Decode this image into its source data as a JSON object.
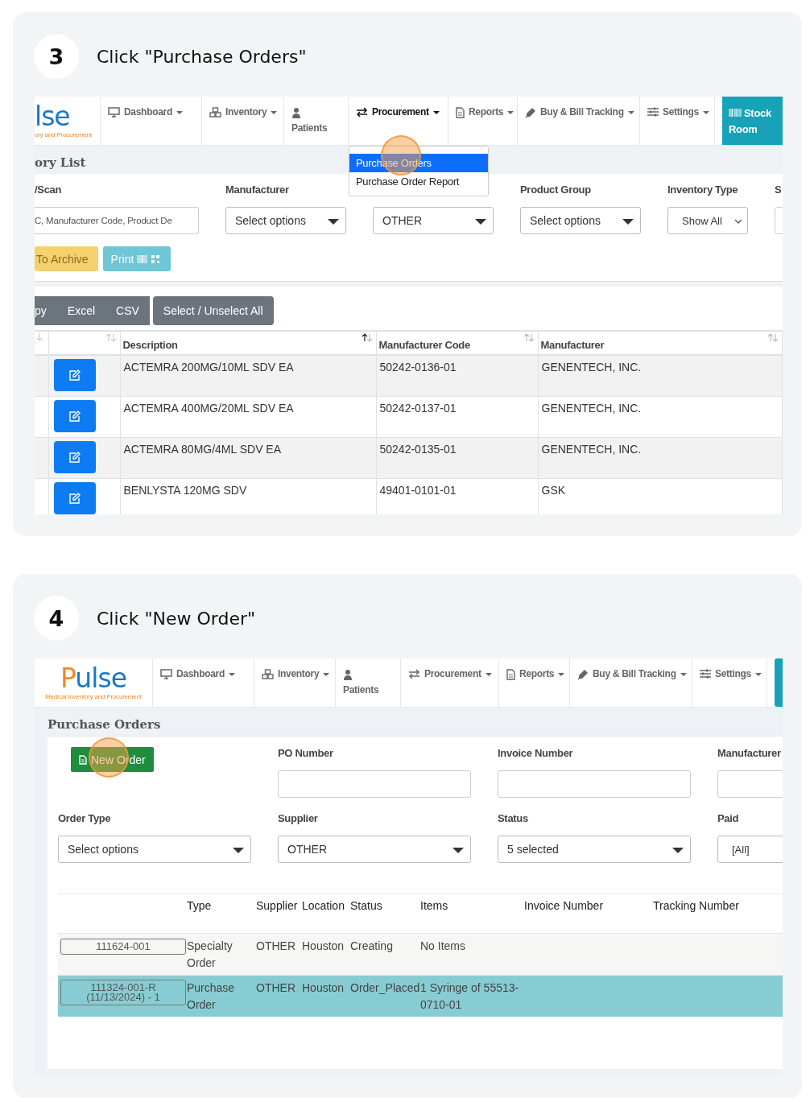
{
  "steps": [
    {
      "kind": "inventory",
      "number": "3",
      "title": "Click \"Purchase Orders\"",
      "screen": {
        "logo": {
          "text": "lse",
          "tagline": "ory and Procurement"
        },
        "nav": [
          {
            "label": "Dashboard",
            "caret": true,
            "selected": false
          },
          {
            "label": "Inventory",
            "caret": true,
            "selected": false
          },
          {
            "label": "Patients",
            "caret": false,
            "selected": false
          },
          {
            "label": "Procurement",
            "caret": true,
            "selected": true
          },
          {
            "label": "Reports",
            "caret": true,
            "selected": false
          },
          {
            "label": "Buy & Bill Tracking",
            "caret": true,
            "selected": false
          },
          {
            "label": "Settings",
            "caret": true,
            "selected": false
          }
        ],
        "cta": {
          "label": "Stock Room",
          "cut": false
        },
        "menu": [
          {
            "label": "Purchase Orders",
            "selected": true
          },
          {
            "label": "Purchase Order Report",
            "selected": false
          }
        ],
        "page_title": "ory List",
        "filters": [
          {
            "label": "/Scan",
            "kind": "text",
            "placeholder": "C, Manufacturer Code, Product De"
          },
          {
            "kind": "select",
            "label": "Manufacturer",
            "value": "Select options"
          },
          {
            "kind": "select",
            "value": "OTHER"
          },
          {
            "kind": "select",
            "label": "Product Group",
            "value": "Select options"
          },
          {
            "kind": "native",
            "label": "Inventory Type",
            "value": "Show All"
          },
          {
            "kind": "text",
            "label": "S"
          }
        ],
        "actions": [
          {
            "label": "To Archive",
            "kind": "warning"
          },
          {
            "label": "Print",
            "kind": "print"
          }
        ],
        "export_buttons": [
          "py",
          "Excel",
          "CSV"
        ],
        "select_all": "Select / Unselect All",
        "columns": [
          {
            "label": "Description",
            "sorted": true
          },
          {
            "label": "Manufacturer Code",
            "sorted": false
          },
          {
            "label": "Manufacturer",
            "sorted": false
          }
        ],
        "rows": [
          {
            "cells": [
              "ACTEMRA 200MG/10ML SDV EA",
              "50242-0136-01",
              "GENENTECH, INC."
            ]
          },
          {
            "cells": [
              "ACTEMRA 400MG/20ML SDV EA",
              "50242-0137-01",
              "GENENTECH, INC."
            ]
          },
          {
            "cells": [
              "ACTEMRA 80MG/4ML SDV EA",
              "50242-0135-01",
              "GENENTECH, INC."
            ]
          },
          {
            "cells": [
              "BENLYSTA 120MG SDV",
              "49401-0101-01",
              "GSK"
            ]
          }
        ]
      }
    },
    {
      "kind": "purchase_orders",
      "number": "4",
      "title": "Click \"New Order\"",
      "screen": {
        "logo": {
          "accent": "P",
          "text": "ulse",
          "tagline": "Medical Inventory and Procurement"
        },
        "nav": [
          {
            "label": "Dashboard",
            "caret": true,
            "selected": false
          },
          {
            "label": "Inventory",
            "caret": true,
            "selected": false
          },
          {
            "label": "Patients",
            "caret": false,
            "selected": false
          },
          {
            "label": "Procurement",
            "caret": true,
            "selected": false
          },
          {
            "label": "Reports",
            "caret": true,
            "selected": false
          },
          {
            "label": "Buy & Bill Tracking",
            "caret": true,
            "selected": false
          },
          {
            "label": "Settings",
            "caret": true,
            "selected": false
          }
        ],
        "cta": {
          "cut": true
        },
        "page_title": "Purchase Orders",
        "new_order": "New Order",
        "filters": [
          {
            "label": "PO Number",
            "kind": "text"
          },
          {
            "label": "Invoice Number",
            "kind": "text"
          },
          {
            "label": "Manufacturer",
            "kind": "text"
          },
          {
            "label": "Order Type",
            "kind": "select",
            "value": "Select options"
          },
          {
            "label": "Supplier",
            "kind": "select",
            "value": "OTHER"
          },
          {
            "label": "Status",
            "kind": "select",
            "value": "5 selected"
          },
          {
            "label": "Paid",
            "kind": "native",
            "value": "[All]"
          }
        ],
        "columns": [
          "Type",
          "Supplier",
          "Location",
          "Status",
          "Items",
          "Invoice Number",
          "Tracking Number"
        ],
        "rows": [
          {
            "po": "111624-001",
            "cells": [
              "Specialty Order",
              "OTHER",
              "Houston",
              "Creating",
              "No Items"
            ],
            "selected": false
          },
          {
            "po": "111324-001-R (11/13/2024) - 1",
            "cells": [
              "Purchase Order",
              "OTHER",
              "Houston",
              "Order_Placed",
              "1 Syringe of 55513-0710-01"
            ],
            "selected": true
          }
        ]
      }
    }
  ]
}
